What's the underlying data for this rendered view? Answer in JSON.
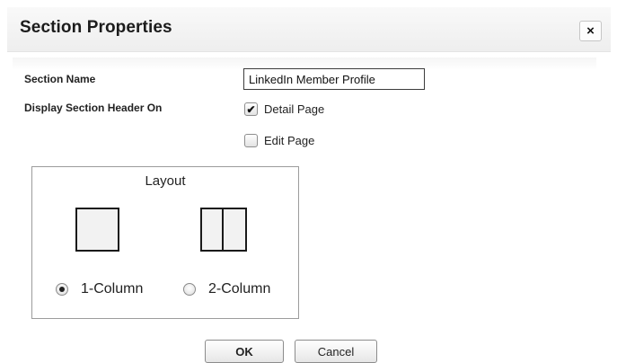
{
  "dialog": {
    "title": "Section Properties",
    "close_label": "×"
  },
  "form": {
    "section_name_label": "Section Name",
    "section_name_value": "LinkedIn Member Profile",
    "display_header_label": "Display Section Header On",
    "detail_page": {
      "label": "Detail Page",
      "checked": true
    },
    "edit_page": {
      "label": "Edit Page",
      "checked": false
    }
  },
  "layout": {
    "title": "Layout",
    "options": [
      {
        "label": "1-Column",
        "selected": true,
        "icon": "one-column-layout-icon"
      },
      {
        "label": "2-Column",
        "selected": false,
        "icon": "two-column-layout-icon"
      }
    ]
  },
  "buttons": {
    "ok": "OK",
    "cancel": "Cancel"
  }
}
